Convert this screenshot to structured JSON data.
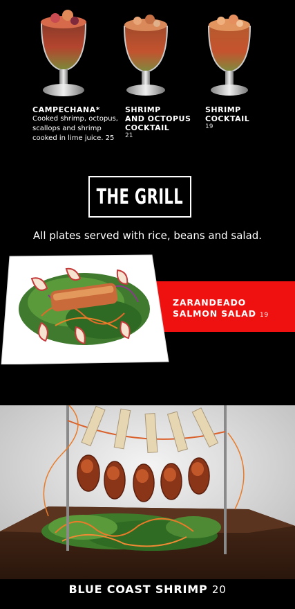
{
  "cocktails": [
    {
      "title": "CAMPECHANA*",
      "desc": "Cooked shrimp, octopus, scallops and shrimp cooked in lime juice. 25",
      "price": ""
    },
    {
      "title_line1": "SHRIMP",
      "title_line2": "AND OCTOPUS",
      "title_line3": "COCKTAIL",
      "price": "21"
    },
    {
      "title_line1": "SHRIMP",
      "title_line2": "COCKTAIL",
      "price": "19"
    }
  ],
  "grill": {
    "heading": "THE GRILL",
    "note": "All plates served with rice, beans and salad."
  },
  "salmon": {
    "line1": "ZARANDEADO",
    "line2": "SALMON SALAD",
    "price": "19"
  },
  "blue_coast": {
    "title": "BLUE COAST SHRIMP",
    "price": "20"
  },
  "colors": {
    "accent_red": "#ef1010",
    "background": "#000000"
  }
}
